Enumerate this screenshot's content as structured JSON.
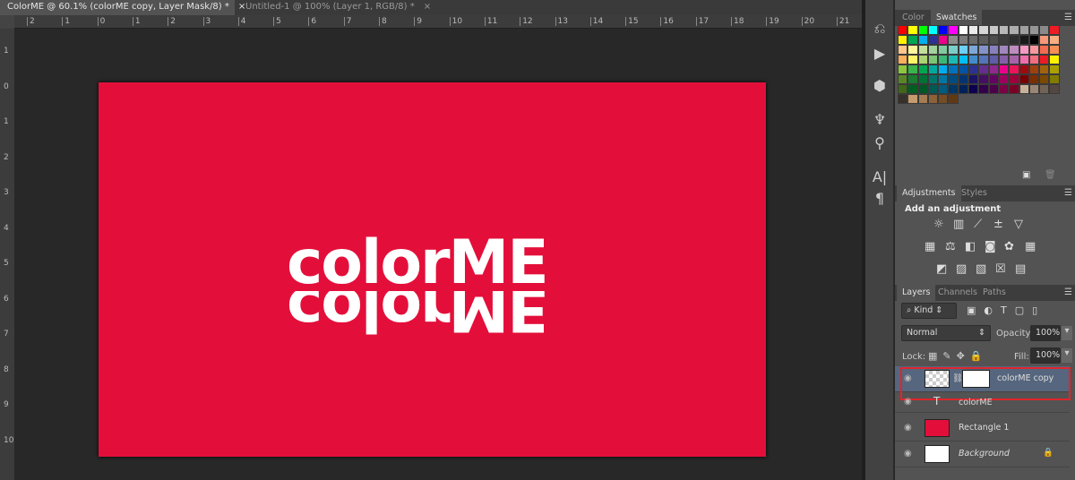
{
  "tabs": [
    {
      "label": "ColorME @ 60.1% (colorME copy, Layer Mask/8) *",
      "active": true
    },
    {
      "label": "Untitled-1 @ 100% (Layer 1, RGB/8) *",
      "active": false
    }
  ],
  "close_glyph": "×",
  "hruler": [
    "2",
    "1",
    "0",
    "1",
    "2",
    "3",
    "4",
    "5",
    "6",
    "7",
    "8",
    "9",
    "10",
    "11",
    "12",
    "13",
    "14",
    "15",
    "16",
    "17",
    "18",
    "19",
    "20",
    "21"
  ],
  "vruler": [
    "1",
    "0",
    "1",
    "2",
    "3",
    "4",
    "5",
    "6",
    "7",
    "8",
    "9",
    "10"
  ],
  "canvas": {
    "background": "#e30f3a",
    "logo_text": "colorME"
  },
  "tools": [
    "history-icon",
    "play-icon",
    "3d-icon",
    "brush-presets-icon",
    "clone-source-icon",
    "character-icon",
    "paragraph-icon"
  ],
  "swatches_panel": {
    "tabs": [
      "Color",
      "Swatches"
    ],
    "active": "Swatches",
    "colors": [
      "#ff0000",
      "#ffff00",
      "#00ff00",
      "#00ffff",
      "#0000ff",
      "#ff00ff",
      "#ffffff",
      "#ebebeb",
      "#d6d6d6",
      "#c8c8c8",
      "#b8b8b8",
      "#adadad",
      "#a0a0a0",
      "#959595",
      "#8a8a8a",
      "#ed1c24",
      "#fff200",
      "#00a651",
      "#00aeef",
      "#2e3192",
      "#ec008c",
      "#8c8c8c",
      "#7b7b7b",
      "#6b6b6b",
      "#5c5c5c",
      "#4d4d4d",
      "#3d3d3d",
      "#2e2e2e",
      "#1a1a1a",
      "#000000",
      "#f7977a",
      "#f9ad81",
      "#fdc68a",
      "#fff79a",
      "#c4df9b",
      "#a3d39c",
      "#82ca9d",
      "#7bcdc8",
      "#6dcff6",
      "#7da7d9",
      "#8393ca",
      "#8781bd",
      "#a187be",
      "#bd8cbf",
      "#f49ac2",
      "#f6989d",
      "#f26c4f",
      "#f68e55",
      "#fbaf5d",
      "#fff467",
      "#acd372",
      "#7cc576",
      "#3bb878",
      "#1abbb4",
      "#00bff3",
      "#438ccb",
      "#5574b9",
      "#605ca8",
      "#855fa8",
      "#a763a8",
      "#f06ea9",
      "#f26d7d",
      "#ed1c24",
      "#fff200",
      "#8dc63f",
      "#39b54a",
      "#00a651",
      "#00a99d",
      "#00aeef",
      "#0072bc",
      "#0054a6",
      "#2e3192",
      "#662d91",
      "#92278f",
      "#ec008c",
      "#ed145b",
      "#9e0b0f",
      "#a0410d",
      "#a36209",
      "#aba000",
      "#598527",
      "#197b30",
      "#007236",
      "#00746b",
      "#0076a3",
      "#004b80",
      "#003471",
      "#1b1464",
      "#440e62",
      "#630460",
      "#9e005d",
      "#9e0039",
      "#790000",
      "#7b2e00",
      "#7d4900",
      "#827b00",
      "#406618",
      "#005e20",
      "#005826",
      "#005952",
      "#005b7f",
      "#003663",
      "#002157",
      "#0d004c",
      "#32004b",
      "#4b0049",
      "#7b0046",
      "#7a0026",
      "#c7b299",
      "#998675",
      "#736357",
      "#534741",
      "#37302a",
      "#c69c6d",
      "#a67c52",
      "#8c6239",
      "#754c24",
      "#603913"
    ]
  },
  "adjustments_panel": {
    "tabs": [
      "Adjustments",
      "Styles"
    ],
    "heading": "Add an adjustment",
    "icons": [
      "brightness-contrast-icon",
      "levels-icon",
      "curves-icon",
      "exposure-icon",
      "vibrance-icon",
      "hue-saturation-icon",
      "color-balance-icon",
      "black-white-icon",
      "photo-filter-icon",
      "channel-mixer-icon",
      "color-lookup-icon",
      "invert-icon",
      "posterize-icon",
      "threshold-icon",
      "selective-color-icon",
      "gradient-map-icon"
    ]
  },
  "layers_panel": {
    "tabs": [
      "Layers",
      "Channels",
      "Paths"
    ],
    "filter": "Kind",
    "blend_mode": "Normal",
    "opacity_label": "Opacity:",
    "opacity": "100%",
    "lock_label": "Lock:",
    "fill_label": "Fill:",
    "fill": "100%",
    "layers": [
      {
        "name": "colorME copy",
        "selected": true
      },
      {
        "name": "colorME",
        "type": "text"
      },
      {
        "name": "Rectangle 1",
        "color": "#e30f3a"
      },
      {
        "name": "Background",
        "locked": true
      }
    ],
    "highlight_color": "#e0252b"
  }
}
